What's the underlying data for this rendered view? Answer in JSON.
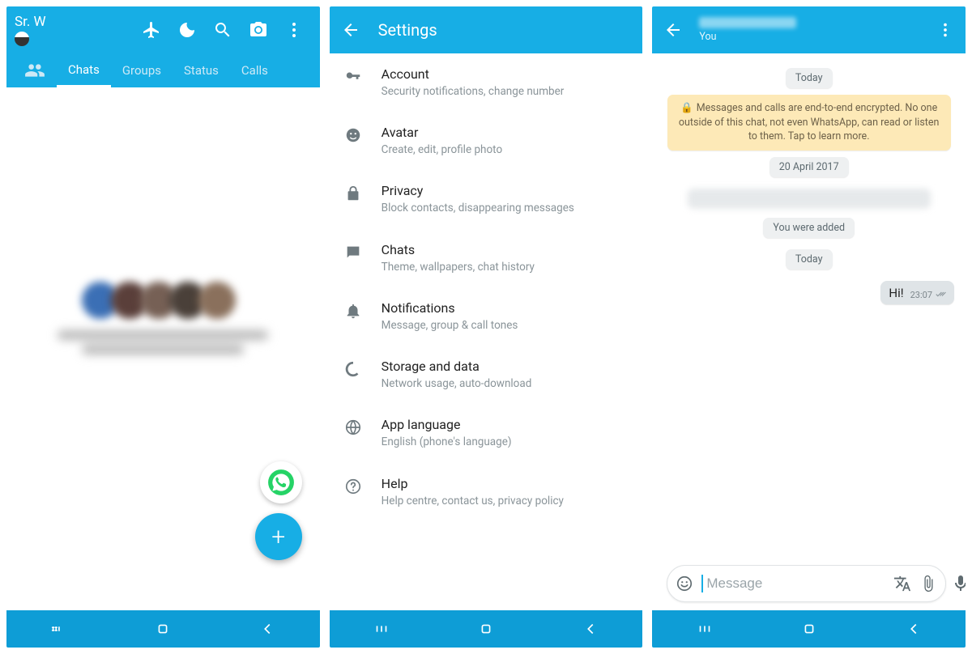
{
  "phone1": {
    "user_name": "Sr. W",
    "tabs": {
      "chats": "Chats",
      "groups": "Groups",
      "status": "Status",
      "calls": "Calls"
    }
  },
  "phone2": {
    "title": "Settings",
    "items": [
      {
        "title": "Account",
        "sub": "Security notifications, change number"
      },
      {
        "title": "Avatar",
        "sub": "Create, edit, profile photo"
      },
      {
        "title": "Privacy",
        "sub": "Block contacts, disappearing messages"
      },
      {
        "title": "Chats",
        "sub": "Theme, wallpapers, chat history"
      },
      {
        "title": "Notifications",
        "sub": "Message, group & call tones"
      },
      {
        "title": "Storage and data",
        "sub": "Network usage, auto-download"
      },
      {
        "title": "App language",
        "sub": "English (phone's language)"
      },
      {
        "title": "Help",
        "sub": "Help centre, contact us, privacy policy"
      }
    ]
  },
  "phone3": {
    "subtitle": "You",
    "date_today": "Today",
    "e2e_text": "Messages and calls are end-to-end encrypted. No one outside of this chat, not even WhatsApp, can read or listen to them. Tap to learn more.",
    "date_old": "20 April 2017",
    "added_text": "You were added",
    "msg_text": "Hi!",
    "msg_time": "23:07",
    "input_placeholder": "Message"
  }
}
